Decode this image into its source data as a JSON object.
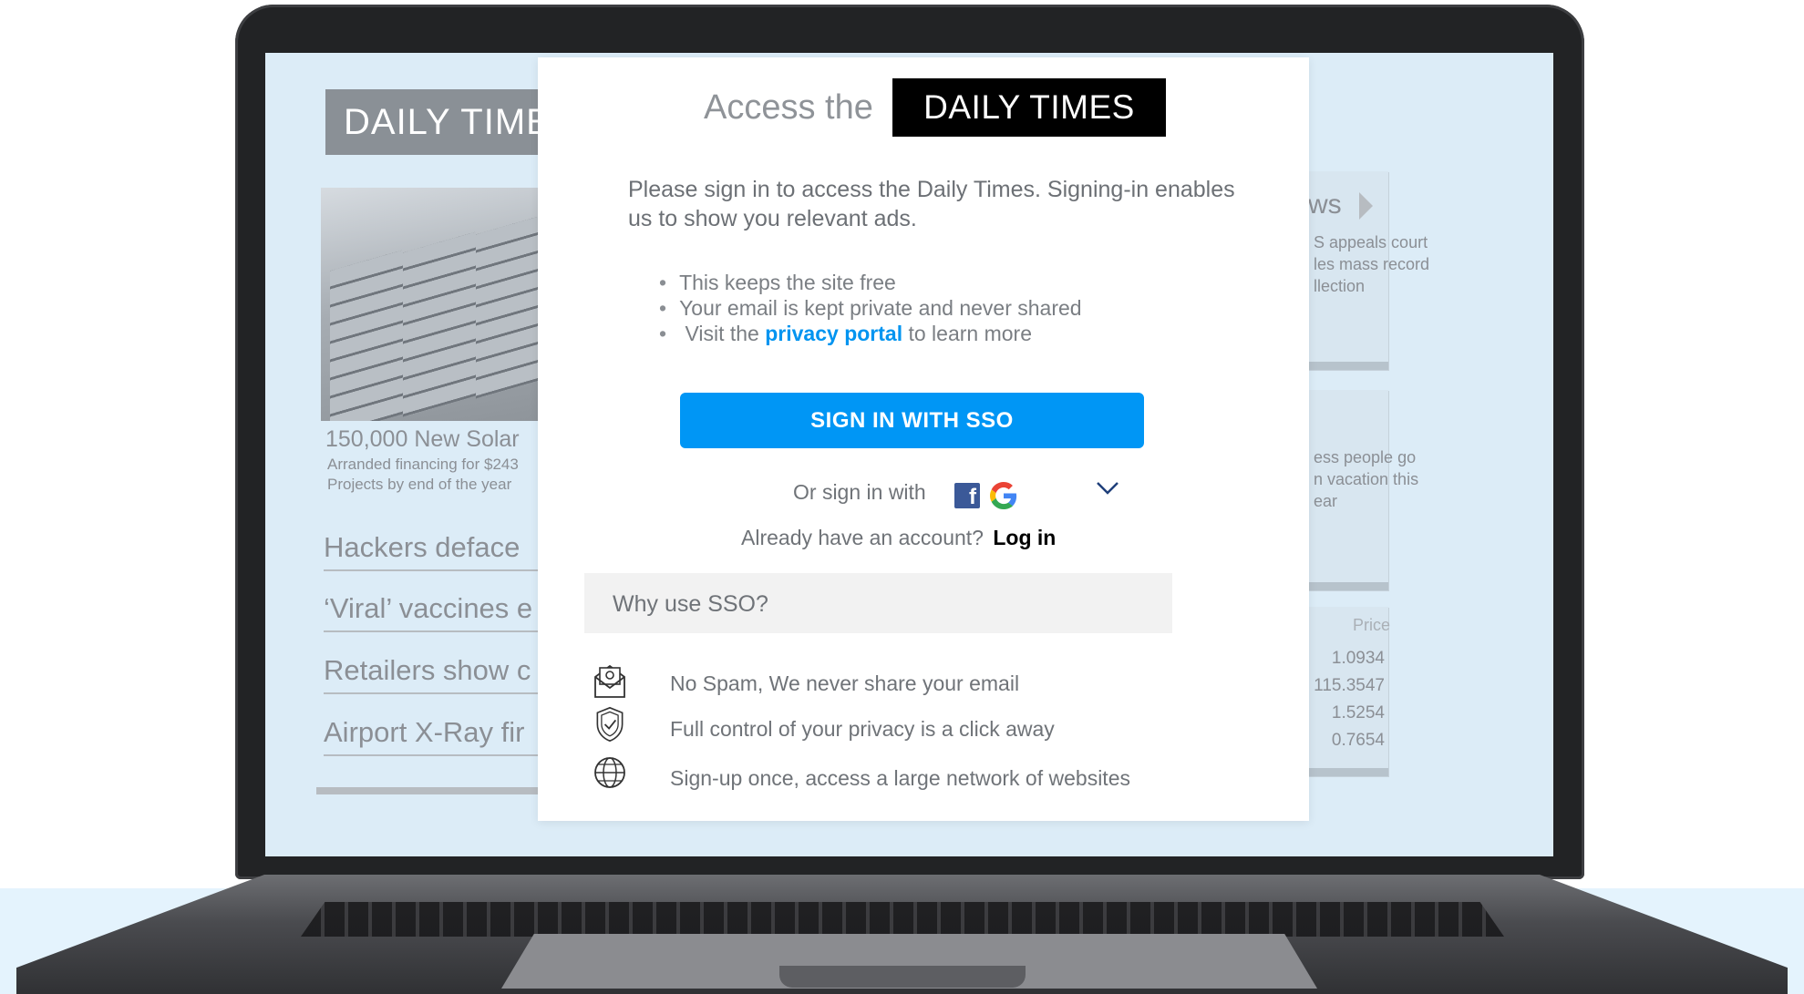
{
  "background": {
    "strip_color": "#e4f3fd"
  },
  "newspaper": {
    "masthead": "DAILY TIMES",
    "headline": "150,000 New Solar",
    "subline_1": "Arranded financing for $243",
    "subline_2": "Projects by end of the year",
    "stories": [
      "Hackers deface",
      "‘Viral’ vaccines e",
      "Retailers show c",
      "Airport X-Ray fir"
    ],
    "side_news_title": "ws",
    "side_news_item": [
      "S appeals court",
      "les mass record",
      "llection"
    ],
    "side_travel_item": [
      "ess people go",
      "n vacation this",
      "ear"
    ],
    "price_header": "Price",
    "prices": [
      "1.0934",
      "115.3547",
      "1.5254",
      "0.7654"
    ]
  },
  "modal": {
    "access_label": "Access the",
    "brand": "DAILY TIMES",
    "intro": "Please sign in to access the Daily Times. Signing-in enables us to show you relevant ads.",
    "bullets": {
      "b1": "This keeps the site free",
      "b2": "Your email is kept private and never shared",
      "b3_pre": "Visit the",
      "b3_link": "privacy portal",
      "b3_post": "to learn more"
    },
    "sso_button": "SIGN IN WITH SSO",
    "alt_signin": "Or sign in with",
    "account_question": "Already have an account?",
    "login_link": "Log in",
    "why_sso": "Why use SSO?",
    "benefits": [
      {
        "icon": "email-icon",
        "text": "No Spam, We never share your email"
      },
      {
        "icon": "shield-icon",
        "text": "Full control of your privacy is a click away"
      },
      {
        "icon": "globe-icon",
        "text": "Sign-up once, access a large network of websites"
      }
    ],
    "colors": {
      "primary": "#0096f5",
      "link": "#0094f0",
      "brand_bg": "#000000"
    }
  }
}
